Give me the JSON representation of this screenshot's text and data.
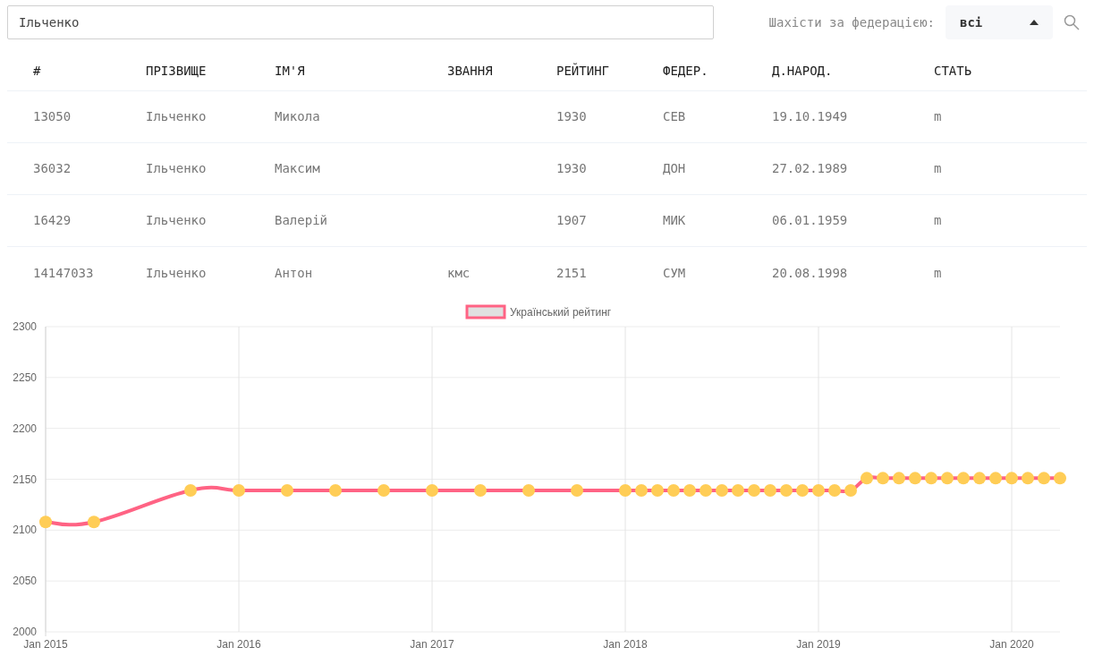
{
  "search": {
    "value": "Ільченко"
  },
  "federation_filter": {
    "label": "Шахісти за федерацією:",
    "value": "всі"
  },
  "table": {
    "columns": [
      "#",
      "ПРІЗВИЩЕ",
      "ІМ'Я",
      "ЗВАННЯ",
      "РЕЙТИНГ",
      "ФЕДЕР.",
      "Д.НАРОД.",
      "СТАТЬ"
    ],
    "rows": [
      [
        "13050",
        "Ільченко",
        "Микола",
        "",
        "1930",
        "СЕВ",
        "19.10.1949",
        "m"
      ],
      [
        "36032",
        "Ільченко",
        "Максим",
        "",
        "1930",
        "ДОН",
        "27.02.1989",
        "m"
      ],
      [
        "16429",
        "Ільченко",
        "Валерій",
        "",
        "1907",
        "МИК",
        "06.01.1959",
        "m"
      ],
      [
        "14147033",
        "Ільченко",
        "Антон",
        "кмс",
        "2151",
        "СУМ",
        "20.08.1998",
        "m"
      ]
    ]
  },
  "chart": {
    "chart_data": {
      "type": "line",
      "grid": true,
      "categories": [
        "Jan 2015",
        null,
        null,
        null,
        null,
        null,
        null,
        null,
        null,
        null,
        null,
        null,
        "Jan 2016",
        null,
        null,
        null,
        null,
        null,
        null,
        null,
        null,
        null,
        null,
        null,
        "Jan 2017",
        null,
        null,
        null,
        null,
        null,
        null,
        null,
        null,
        null,
        null,
        null,
        "Jan 2018",
        null,
        null,
        null,
        null,
        null,
        null,
        null,
        null,
        null,
        null,
        null,
        "Jan 2019",
        null,
        null,
        null,
        null,
        null,
        null,
        null,
        null,
        null,
        null,
        null,
        "Jan 2020",
        null,
        null,
        null
      ],
      "series": [
        {
          "name": "Український рейтинг",
          "color": "#ff6384",
          "marker": "circle",
          "values": [
            2108,
            null,
            null,
            2108,
            null,
            null,
            null,
            null,
            null,
            2139,
            null,
            null,
            2139,
            null,
            null,
            2139,
            null,
            null,
            2139,
            null,
            null,
            2139,
            null,
            null,
            2139,
            null,
            null,
            2139,
            null,
            null,
            2139,
            null,
            null,
            2139,
            null,
            null,
            2139,
            2139,
            2139,
            2139,
            2139,
            2139,
            2139,
            2139,
            2139,
            2139,
            2139,
            2139,
            2139,
            2139,
            2139,
            2151,
            2151,
            2151,
            2151,
            2151,
            2151,
            2151,
            2151,
            2151,
            2151,
            2151,
            2151,
            2151
          ]
        }
      ],
      "ylim": [
        2000,
        2300
      ],
      "yticks": [
        2000,
        2050,
        2100,
        2150,
        2200,
        2250,
        2300
      ]
    }
  }
}
